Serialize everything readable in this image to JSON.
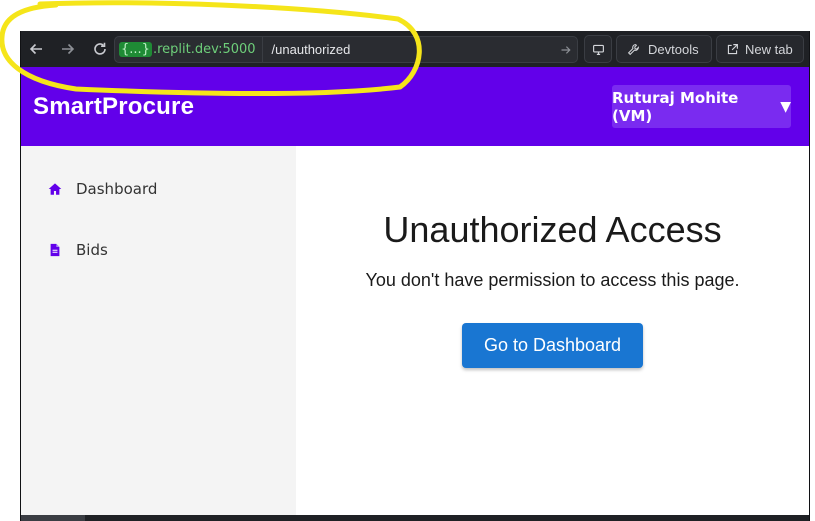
{
  "browser": {
    "url_chip": "{...}",
    "url_host": ".replit.dev:5000",
    "url_path": "/unauthorized",
    "devtools_label": "Devtools",
    "new_tab_label": "New tab"
  },
  "app": {
    "brand": "SmartProcure",
    "user_menu": "Ruturaj Mohite (VM)",
    "user_menu_caret": "▼",
    "colors": {
      "header": "#6200ea",
      "primary_button": "#1976d2",
      "sidebar": "#f4f4f4",
      "annotation": "#f5e51a"
    }
  },
  "sidebar": {
    "items": [
      {
        "label": "Dashboard",
        "icon": "home-icon"
      },
      {
        "label": "Bids",
        "icon": "file-icon"
      }
    ]
  },
  "main": {
    "title": "Unauthorized Access",
    "message": "You don't have permission to access this page.",
    "button_label": "Go to Dashboard"
  }
}
